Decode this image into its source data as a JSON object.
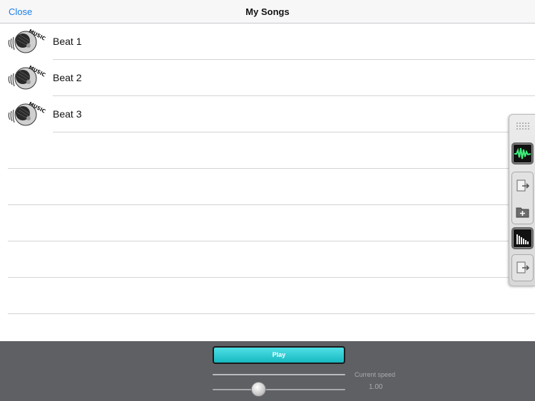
{
  "navbar": {
    "close_label": "Close",
    "title": "My Songs"
  },
  "songs": [
    {
      "title": "Beat 1",
      "icon": "music-disc-icon",
      "icon_text": "MUSIC"
    },
    {
      "title": "Beat 2",
      "icon": "music-disc-icon",
      "icon_text": "MUSIC"
    },
    {
      "title": "Beat 3",
      "icon": "music-disc-icon",
      "icon_text": "MUSIC"
    }
  ],
  "dock": {
    "items": [
      "grip-handle",
      "waveform-icon",
      "export-icon",
      "new-folder-icon",
      "equalizer-icon",
      "import-icon"
    ]
  },
  "player": {
    "play_label": "Play",
    "speed_label": "Current speed",
    "speed_value": "1.00"
  },
  "colors": {
    "accent": "#1a7ee6",
    "play_button": "#17b9c1",
    "bottom_bar": "#5f6064"
  }
}
